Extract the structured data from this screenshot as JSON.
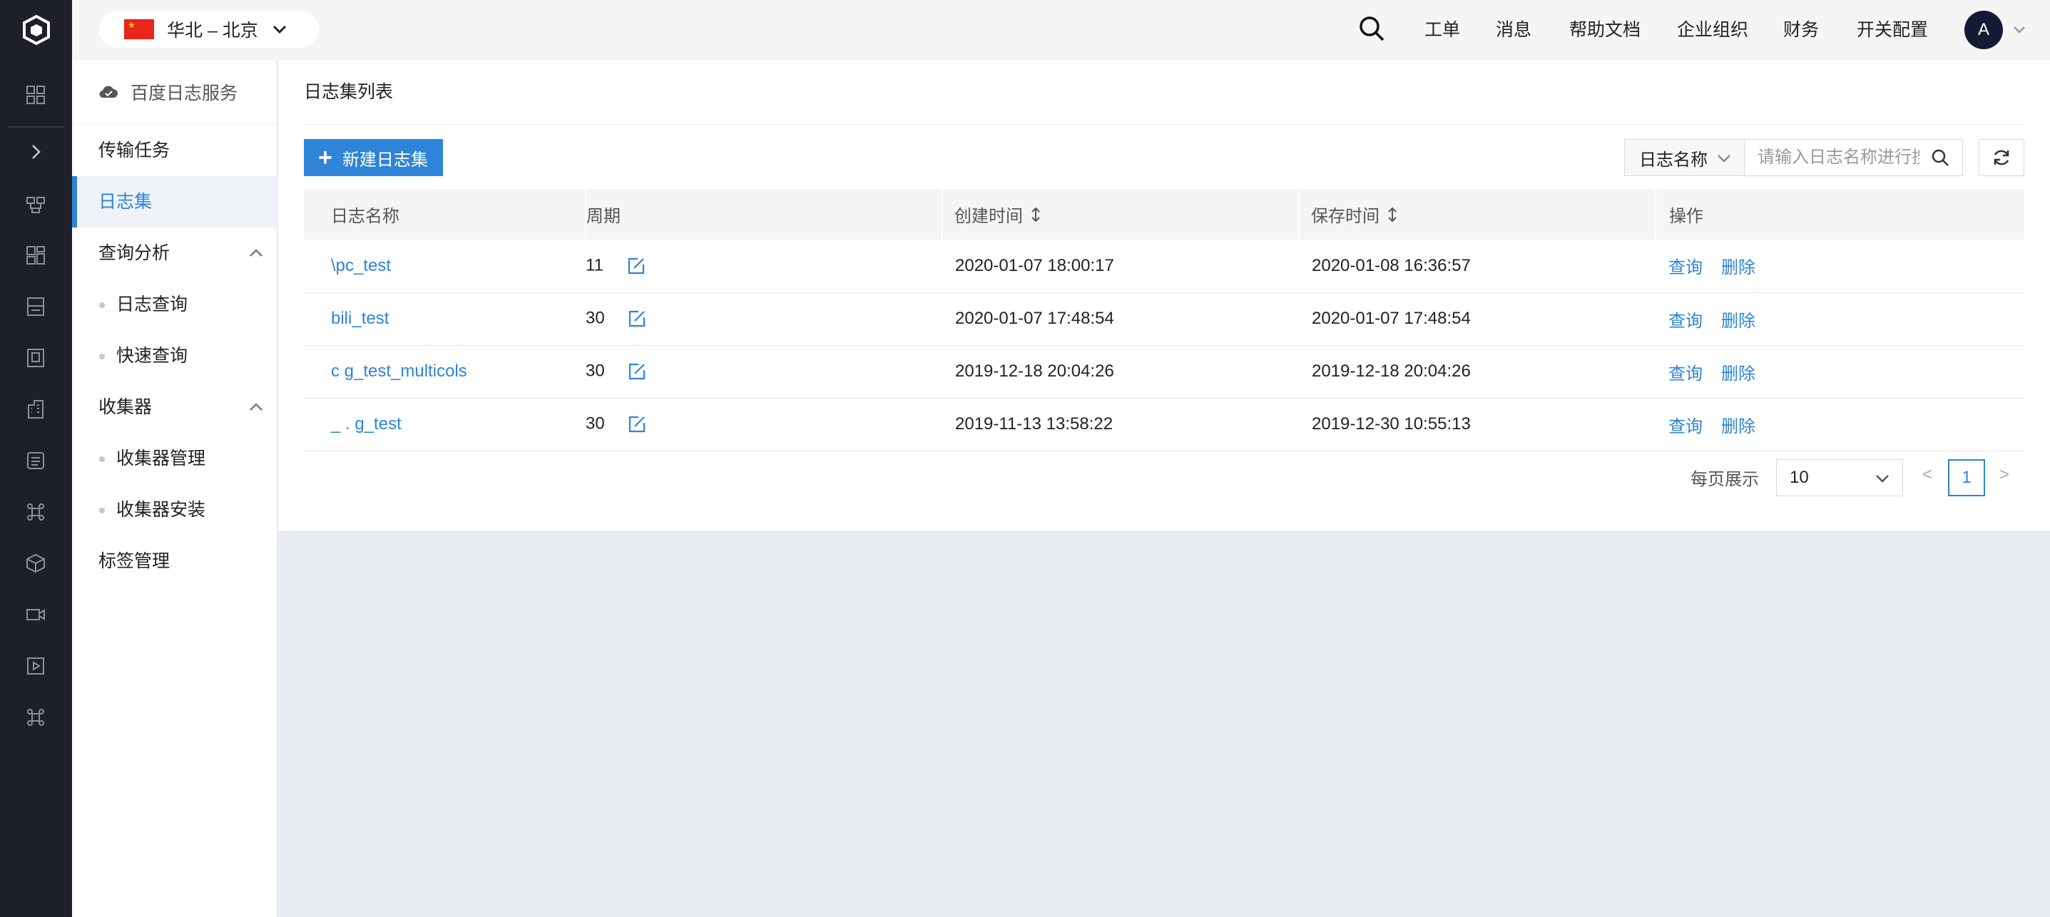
{
  "topbar": {
    "region": "华北 – 北京",
    "nav": [
      "工单",
      "消息",
      "帮助文档",
      "企业组织",
      "财务",
      "开关配置"
    ],
    "avatar_letter": "A"
  },
  "rail": {
    "icons": [
      "dashboard-icon",
      "expand-icon",
      "modules-icon",
      "grid-icon",
      "storage-icon",
      "building-icon",
      "office-icon",
      "database-icon",
      "command-icon",
      "box-icon",
      "video-icon",
      "play-icon",
      "command-icon"
    ]
  },
  "subnav": {
    "header": "百度日志服务",
    "items": [
      {
        "label": "传输任务"
      },
      {
        "label": "日志集"
      },
      {
        "label": "查询分析"
      },
      {
        "label": "日志查询"
      },
      {
        "label": "快速查询"
      },
      {
        "label": "收集器"
      },
      {
        "label": "收集器管理"
      },
      {
        "label": "收集器安装"
      },
      {
        "label": "标签管理"
      }
    ]
  },
  "main": {
    "title": "日志集列表",
    "new_button": "新建日志集",
    "filter_label": "日志名称",
    "search_placeholder": "请输入日志名称进行搜索",
    "columns": [
      "日志名称",
      "周期",
      "创建时间",
      "保存时间",
      "操作"
    ],
    "rows": [
      {
        "name": "\\pc_test",
        "period": "11",
        "created": "2020-01-07 18:00:17",
        "saved": "2020-01-08 16:36:57"
      },
      {
        "name": "bili_test",
        "period": "30",
        "created": "2020-01-07 17:48:54",
        "saved": "2020-01-07 17:48:54"
      },
      {
        "name": "c    g_test_multicols",
        "period": "30",
        "created": "2019-12-18 20:04:26",
        "saved": "2019-12-18 20:04:26"
      },
      {
        "name": "  _ .  g_test",
        "period": "30",
        "created": "2019-11-13 13:58:22",
        "saved": "2019-12-30 10:55:13"
      }
    ],
    "action_query": "查询",
    "action_delete": "删除",
    "pager": {
      "per_page_label": "每页展示",
      "page_size": "10",
      "prev": "<",
      "next": ">",
      "current": "1"
    }
  },
  "colors": {
    "accent": "#2d84d9",
    "rail": "#1d2029",
    "avatar": "#151a33"
  }
}
